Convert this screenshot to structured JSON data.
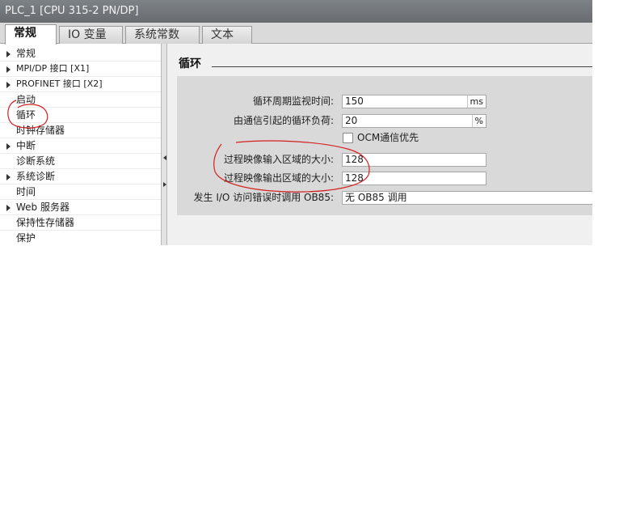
{
  "window": {
    "title": "PLC_1 [CPU 315-2 PN/DP]"
  },
  "tabs": [
    {
      "label": "常规",
      "active": true
    },
    {
      "label": "IO 变量",
      "active": false
    },
    {
      "label": "系统常数",
      "active": false
    },
    {
      "label": "文本",
      "active": false
    }
  ],
  "nav": {
    "items": [
      {
        "label": "常规",
        "expandable": true
      },
      {
        "label": "MPI/DP 接口 [X1]",
        "expandable": true
      },
      {
        "label": "PROFINET 接口 [X2]",
        "expandable": true
      },
      {
        "label": "启动",
        "expandable": false
      },
      {
        "label": "循环",
        "expandable": false,
        "selected": true
      },
      {
        "label": "时钟存储器",
        "expandable": false
      },
      {
        "label": "中断",
        "expandable": true
      },
      {
        "label": "诊断系统",
        "expandable": false
      },
      {
        "label": "系统诊断",
        "expandable": true
      },
      {
        "label": "时间",
        "expandable": false
      },
      {
        "label": "Web 服务器",
        "expandable": true
      },
      {
        "label": "保持性存储器",
        "expandable": false
      },
      {
        "label": "保护",
        "expandable": false
      }
    ]
  },
  "section": {
    "title": "循环",
    "fields": {
      "cycle_monitor": {
        "label": "循环周期监视时间:",
        "value": "150",
        "unit": "ms"
      },
      "comm_load": {
        "label": "由通信引起的循环负荷:",
        "value": "20",
        "unit": "%"
      },
      "ocm_priority": {
        "label": "OCM通信优先",
        "checked": false
      },
      "input_image_size": {
        "label": "过程映像输入区域的大小:",
        "value": "128"
      },
      "output_image_size": {
        "label": "过程映像输出区域的大小:",
        "value": "128"
      },
      "ob85": {
        "label": "发生 I/O 访问错误时调用 OB85:",
        "value": "无 OB85 调用"
      }
    }
  },
  "annotation_color": "#d42020"
}
